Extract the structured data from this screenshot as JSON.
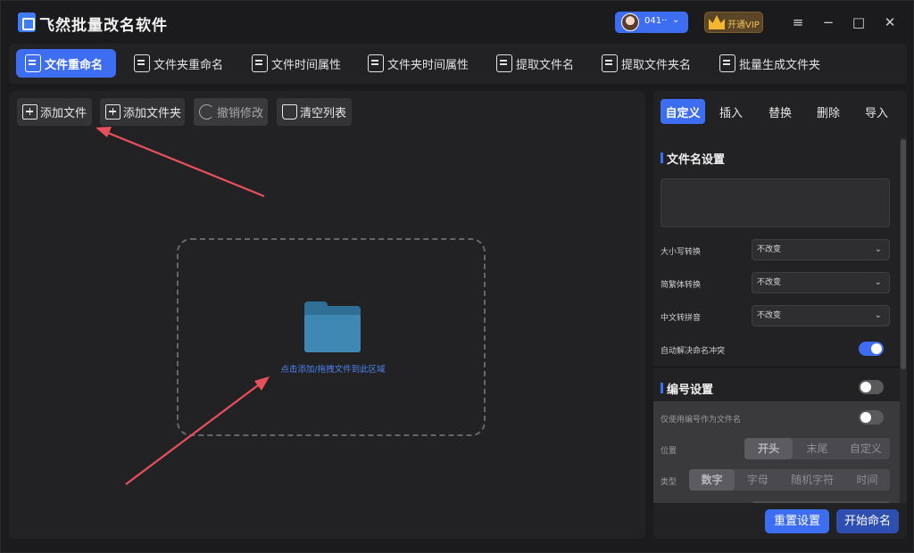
{
  "app": {
    "title": "飞然批量改名软件"
  },
  "user": {
    "name": "041··",
    "vip_label": "开通VIP"
  },
  "window_controls": {
    "menu": "≡",
    "minimize": "−",
    "maximize": "□",
    "close": "✕"
  },
  "tabs": [
    {
      "label": "文件重命名",
      "active": true
    },
    {
      "label": "文件夹重命名",
      "active": false
    },
    {
      "label": "文件时间属性",
      "active": false
    },
    {
      "label": "文件夹时间属性",
      "active": false
    },
    {
      "label": "提取文件名",
      "active": false
    },
    {
      "label": "提取文件夹名",
      "active": false
    },
    {
      "label": "批量生成文件夹",
      "active": false
    }
  ],
  "toolbar": {
    "add_file": "添加文件",
    "add_folder": "添加文件夹",
    "undo": "撤销修改",
    "clear": "清空列表"
  },
  "dropzone": {
    "hint": "点击添加/拖拽文件到此区域"
  },
  "right_tabs": [
    {
      "label": "自定义",
      "active": true
    },
    {
      "label": "插入",
      "active": false
    },
    {
      "label": "替换",
      "active": false
    },
    {
      "label": "删除",
      "active": false
    },
    {
      "label": "导入",
      "active": false
    }
  ],
  "filename_settings": {
    "title": "文件名设置",
    "case_label": "大小写转换",
    "case_value": "不改变",
    "simp_trad_label": "简繁体转换",
    "simp_trad_value": "不改变",
    "pinyin_label": "中文转拼音",
    "pinyin_value": "不改变",
    "auto_resolve_label": "自动解决命名冲突",
    "auto_resolve_on": true
  },
  "numbering": {
    "title": "编号设置",
    "enabled": false,
    "only_number_label": "仅使用编号作为文件名",
    "only_number_on": false,
    "position_label": "位置",
    "position_options": [
      "开头",
      "末尾",
      "自定义"
    ],
    "position_selected": "开头",
    "type_label": "类型",
    "type_options": [
      "数字",
      "字母",
      "随机字符",
      "时间"
    ],
    "type_selected": "数字"
  },
  "footer": {
    "reset": "重置设置",
    "start": "开始命名"
  },
  "colors": {
    "accent": "#3d6df0",
    "arrow": "#e8505b",
    "vip": "#f2b632"
  }
}
